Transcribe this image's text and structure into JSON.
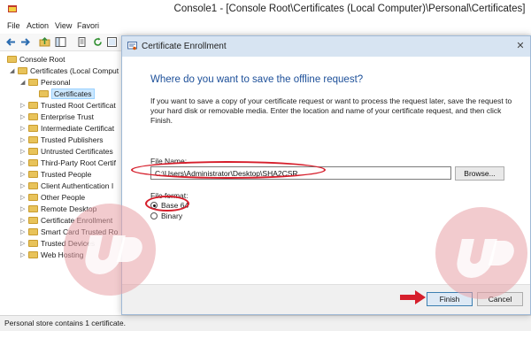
{
  "window": {
    "title": "Console1 - [Console Root\\Certificates (Local Computer)\\Personal\\Certificates]"
  },
  "menu": [
    "File",
    "Action",
    "View",
    "Favori"
  ],
  "tree": [
    {
      "label": "Console Root",
      "indent": 0,
      "arrow": ""
    },
    {
      "label": "Certificates (Local Comput",
      "indent": 1,
      "arrow": "◢"
    },
    {
      "label": "Personal",
      "indent": 2,
      "arrow": "◢"
    },
    {
      "label": "Certificates",
      "indent": 3,
      "arrow": "",
      "selected": true
    },
    {
      "label": "Trusted Root Certificat",
      "indent": 2,
      "arrow": "▷"
    },
    {
      "label": "Enterprise Trust",
      "indent": 2,
      "arrow": "▷"
    },
    {
      "label": "Intermediate Certificat",
      "indent": 2,
      "arrow": "▷"
    },
    {
      "label": "Trusted Publishers",
      "indent": 2,
      "arrow": "▷"
    },
    {
      "label": "Untrusted Certificates",
      "indent": 2,
      "arrow": "▷"
    },
    {
      "label": "Third-Party Root Certif",
      "indent": 2,
      "arrow": "▷"
    },
    {
      "label": "Trusted People",
      "indent": 2,
      "arrow": "▷"
    },
    {
      "label": "Client Authentication I",
      "indent": 2,
      "arrow": "▷"
    },
    {
      "label": "Other People",
      "indent": 2,
      "arrow": "▷"
    },
    {
      "label": "Remote Desktop",
      "indent": 2,
      "arrow": "▷"
    },
    {
      "label": "Certificate Enrollment",
      "indent": 2,
      "arrow": "▷"
    },
    {
      "label": "Smart Card Trusted Ro",
      "indent": 2,
      "arrow": "▷"
    },
    {
      "label": "Trusted Devices",
      "indent": 2,
      "arrow": "▷"
    },
    {
      "label": "Web Hosting",
      "indent": 2,
      "arrow": "▷"
    }
  ],
  "status": "Personal store contains 1 certificate.",
  "dialog": {
    "title": "Certificate Enrollment",
    "close": "✕",
    "heading": "Where do you want to save the offline request?",
    "description": "If you want to save a copy of your certificate request or want to process the request later, save the request to your hard disk or removable media. Enter the location and name of your certificate request, and then click Finish.",
    "file_name_label": "File Name:",
    "file_name_value": "C:\\Users\\Administrator\\Desktop\\SHA2CSR",
    "browse_label": "Browse...",
    "file_format_label": "File format:",
    "formats": [
      {
        "label": "Base 64",
        "checked": true
      },
      {
        "label": "Binary",
        "checked": false
      }
    ],
    "finish_label": "Finish",
    "cancel_label": "Cancel"
  },
  "colors": {
    "annotation": "#d61f2c",
    "heading": "#1c4f99",
    "watermark": "#e8a0a6"
  }
}
